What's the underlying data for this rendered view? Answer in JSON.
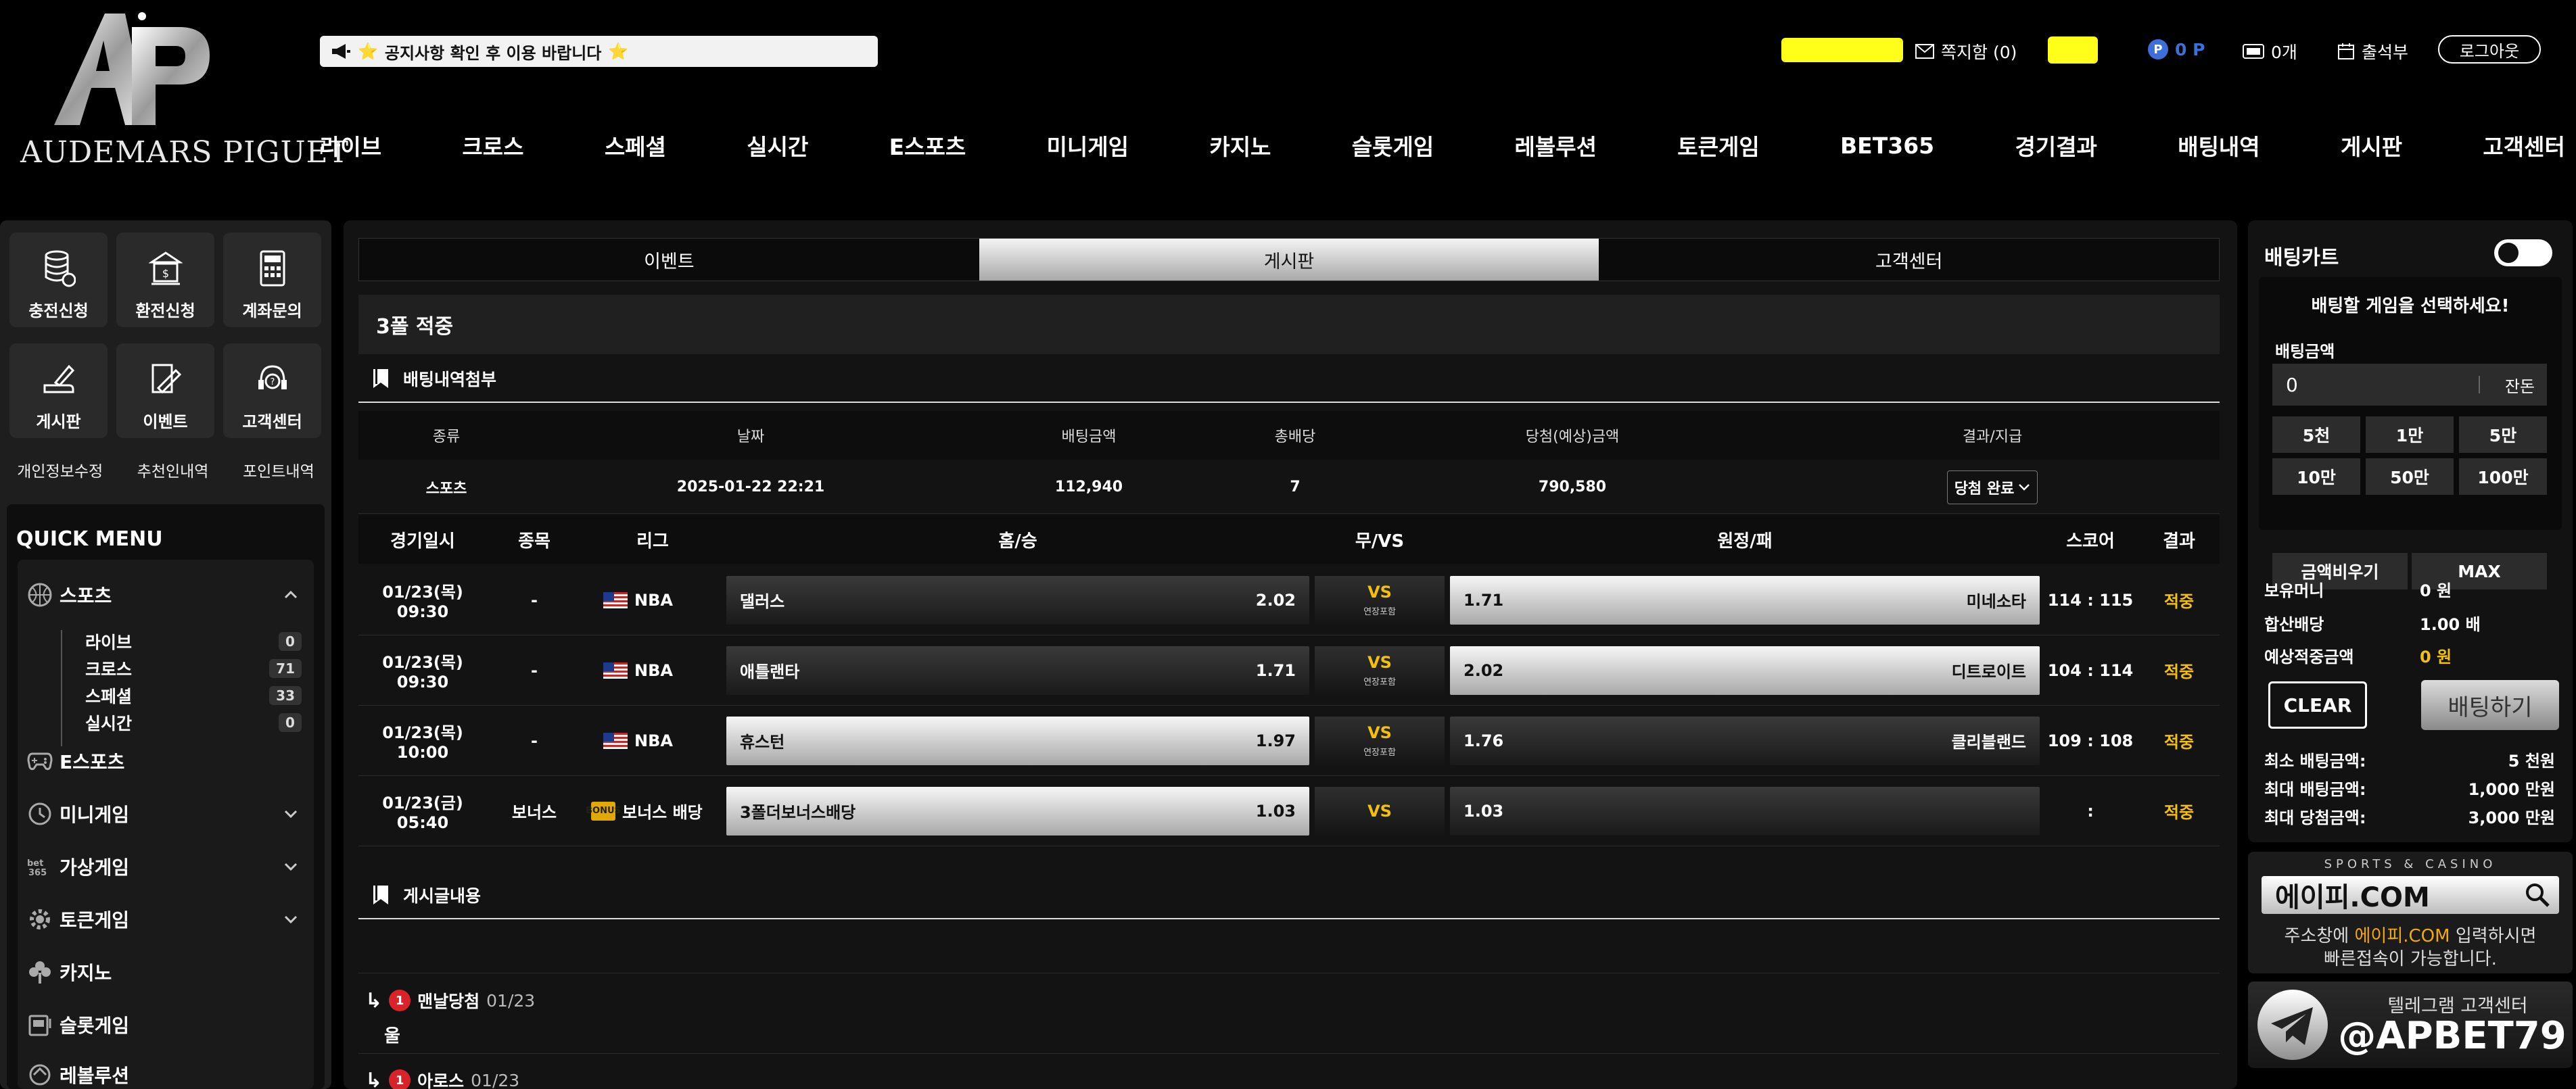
{
  "brand": {
    "name": "AUDEMARS PIGUET",
    "monogram": "AP"
  },
  "notice": {
    "text": "공지사항 확인 후 이용 바랍니다",
    "star": "⭐"
  },
  "topbar": {
    "messages": "쪽지함 (0)",
    "points": "0 P",
    "points_badge": "P",
    "coupons": "0개",
    "attendance": "출석부",
    "logout": "로그아웃"
  },
  "nav": [
    "라이브",
    "크로스",
    "스페셜",
    "실시간",
    "E스포츠",
    "미니게임",
    "카지노",
    "슬롯게임",
    "레볼루션",
    "토큰게임",
    "BET365",
    "경기결과",
    "배팅내역",
    "게시판",
    "고객센터"
  ],
  "quick_tiles": [
    "충전신청",
    "환전신청",
    "계좌문의",
    "게시판",
    "이벤트",
    "고객센터"
  ],
  "sub_links": [
    "개인정보수정",
    "추천인내역",
    "포인트내역"
  ],
  "quick_menu": {
    "title": "QUICK MENU",
    "sports": "스포츠",
    "sports_items": [
      {
        "label": "라이브",
        "count": "0"
      },
      {
        "label": "크로스",
        "count": "71"
      },
      {
        "label": "스페셜",
        "count": "33"
      },
      {
        "label": "실시간",
        "count": "0"
      }
    ],
    "items": [
      "E스포츠",
      "미니게임",
      "가상게임",
      "토큰게임",
      "카지노",
      "슬롯게임",
      "레볼루션"
    ]
  },
  "tabs": [
    "이벤트",
    "게시판",
    "고객센터"
  ],
  "post": {
    "title": "3폴 적중",
    "bet_section": "배팅내역첨부",
    "bet_headers": [
      "종류",
      "날짜",
      "배팅금액",
      "총배당",
      "당첨(예상)금액",
      "결과/지급"
    ],
    "bet_row": [
      "스포츠",
      "2025-01-22 22:21",
      "112,940",
      "7",
      "790,580"
    ],
    "bet_status": "당첨 완료",
    "game_headers": [
      "경기일시",
      "종목",
      "리그",
      "홈/승",
      "무/VS",
      "원정/패",
      "스코어",
      "결과"
    ],
    "games": [
      {
        "time": "01/23(목) 09:30",
        "sport": "-",
        "league": "NBA",
        "home": "댈러스",
        "home_odds": "2.02",
        "vs": "VS",
        "vs_note": "연장포함",
        "away": "미네소타",
        "away_odds": "1.71",
        "score": "114 : 115",
        "result": "적중"
      },
      {
        "time": "01/23(목) 09:30",
        "sport": "-",
        "league": "NBA",
        "home": "애틀랜타",
        "home_odds": "1.71",
        "vs": "VS",
        "vs_note": "연장포함",
        "away": "디트로이트",
        "away_odds": "2.02",
        "score": "104 : 114",
        "result": "적중"
      },
      {
        "time": "01/23(목) 10:00",
        "sport": "-",
        "league": "NBA",
        "home": "휴스턴",
        "home_odds": "1.97",
        "vs": "VS",
        "vs_note": "연장포함",
        "away": "클리블랜드",
        "away_odds": "1.76",
        "score": "109 : 108",
        "result": "적중"
      },
      {
        "time": "01/23(금) 05:40",
        "sport": "보너스",
        "league": "보너스 배당",
        "home": "3폴더보너스배당",
        "home_odds": "1.03",
        "vs": "VS",
        "vs_note": "",
        "away": "",
        "away_odds": "1.03",
        "score": ":",
        "result": "적중"
      }
    ],
    "bonus_icon": "BONUS",
    "content_section": "게시글내용",
    "comments": [
      {
        "arrow": "↳",
        "badge": "1",
        "author": "맨날당첨",
        "date": "01/23",
        "body": "울"
      },
      {
        "arrow": "↳",
        "badge": "1",
        "author": "아로스",
        "date": "01/23"
      }
    ]
  },
  "slip": {
    "title": "배팅카트",
    "message": "배팅할 게임을 선택하세요!",
    "amount_label": "배팅금액",
    "amount_value": "0",
    "change": "잔돈",
    "quick_amounts": [
      "5천",
      "1만",
      "5만",
      "10만",
      "50만",
      "100만"
    ],
    "clear_amount": "금액비우기",
    "max": "MAX",
    "balance_label": "보유머니",
    "balance_value": "0 원",
    "combined_label": "합산배당",
    "combined_value": "1.00 배",
    "expected_label": "예상적중금액",
    "expected_value": "0 원",
    "clear_btn": "CLEAR",
    "bet_btn": "배팅하기",
    "limits": [
      {
        "label": "최소 배팅금액:",
        "value": "5 천원"
      },
      {
        "label": "최대 배팅금액:",
        "value": "1,000 만원"
      },
      {
        "label": "최대 당첨금액:",
        "value": "3,000 만원"
      }
    ]
  },
  "banner1": {
    "top": "SPORTS & CASINO",
    "domain": "에이피.COM",
    "line1_pre": "주소창에 ",
    "line1_hl": "에이피.COM",
    "line1_post": " 입력하시면",
    "line2": "빠른접속이 가능합니다."
  },
  "banner2": {
    "line1": "텔레그램 고객센터",
    "handle": "@APBET79"
  },
  "colors": {
    "accent_gold": "#f3c00a",
    "highlight_yellow": "#ffff1a",
    "points_blue": "#3b6fd9",
    "badge_red": "#d8232a"
  }
}
